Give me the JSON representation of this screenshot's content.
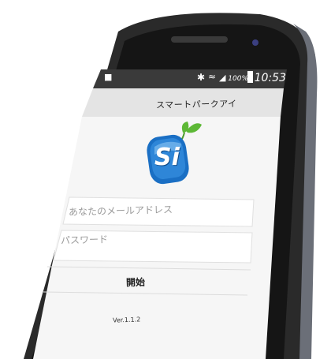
{
  "status_bar": {
    "time": "10:53",
    "battery_percent": "100%",
    "icons": [
      "notification-icon",
      "bluetooth-icon",
      "wifi-icon",
      "signal-icon",
      "battery-icon"
    ]
  },
  "app": {
    "title": "スマートパークアイ",
    "logo_text": "Si",
    "email_placeholder": "あなたのメールアドレス",
    "password_placeholder": "パスワード",
    "start_label": "開始",
    "version": "Ver.1.1.2"
  },
  "colors": {
    "phone_frame": "#1e1e1e",
    "status_bar": "#3a3a3a",
    "screen_bg": "#f4f4f4",
    "logo_blue": "#1a6fc4",
    "leaf_green": "#5db836"
  }
}
